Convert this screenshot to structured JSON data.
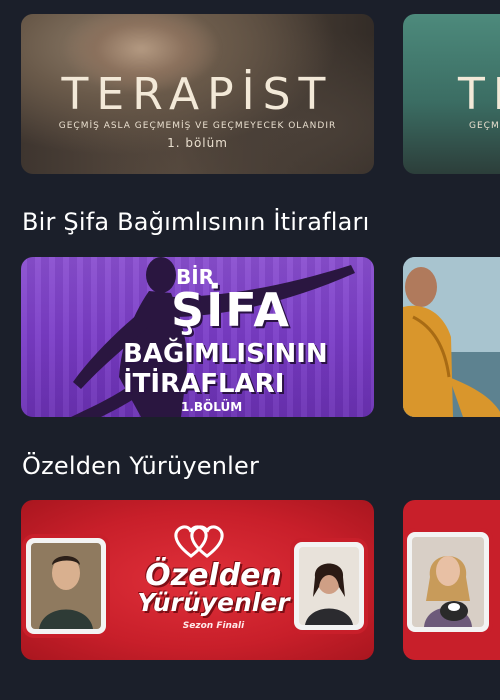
{
  "rows": [
    {
      "title": "",
      "main_card": {
        "show": "TERAPİST",
        "tagline": "GEÇMİŞ ASLA GEÇMEMİŞ VE GEÇMEYECEK OLANDIR",
        "episode": "1. bölüm"
      },
      "peek_card": {
        "show": "TE",
        "tagline": "GEÇMİ"
      }
    },
    {
      "title": "Bir Şifa Bağımlısının İtirafları",
      "main_card": {
        "line1": "BİR",
        "line2": "ŞİFA",
        "line3": "BAĞIMLISININ",
        "line4": "İTİRAFLARI",
        "episode": "1.BÖLÜM"
      }
    },
    {
      "title": "Özelden Yürüyenler",
      "main_card": {
        "line1": "Özelden",
        "line2": "Yürüyenler",
        "subtitle": "Sezon Finali"
      }
    }
  ],
  "colors": {
    "background": "#1b1f2a",
    "accent_purple": "#7a3cc7",
    "accent_red": "#c81f2a"
  }
}
